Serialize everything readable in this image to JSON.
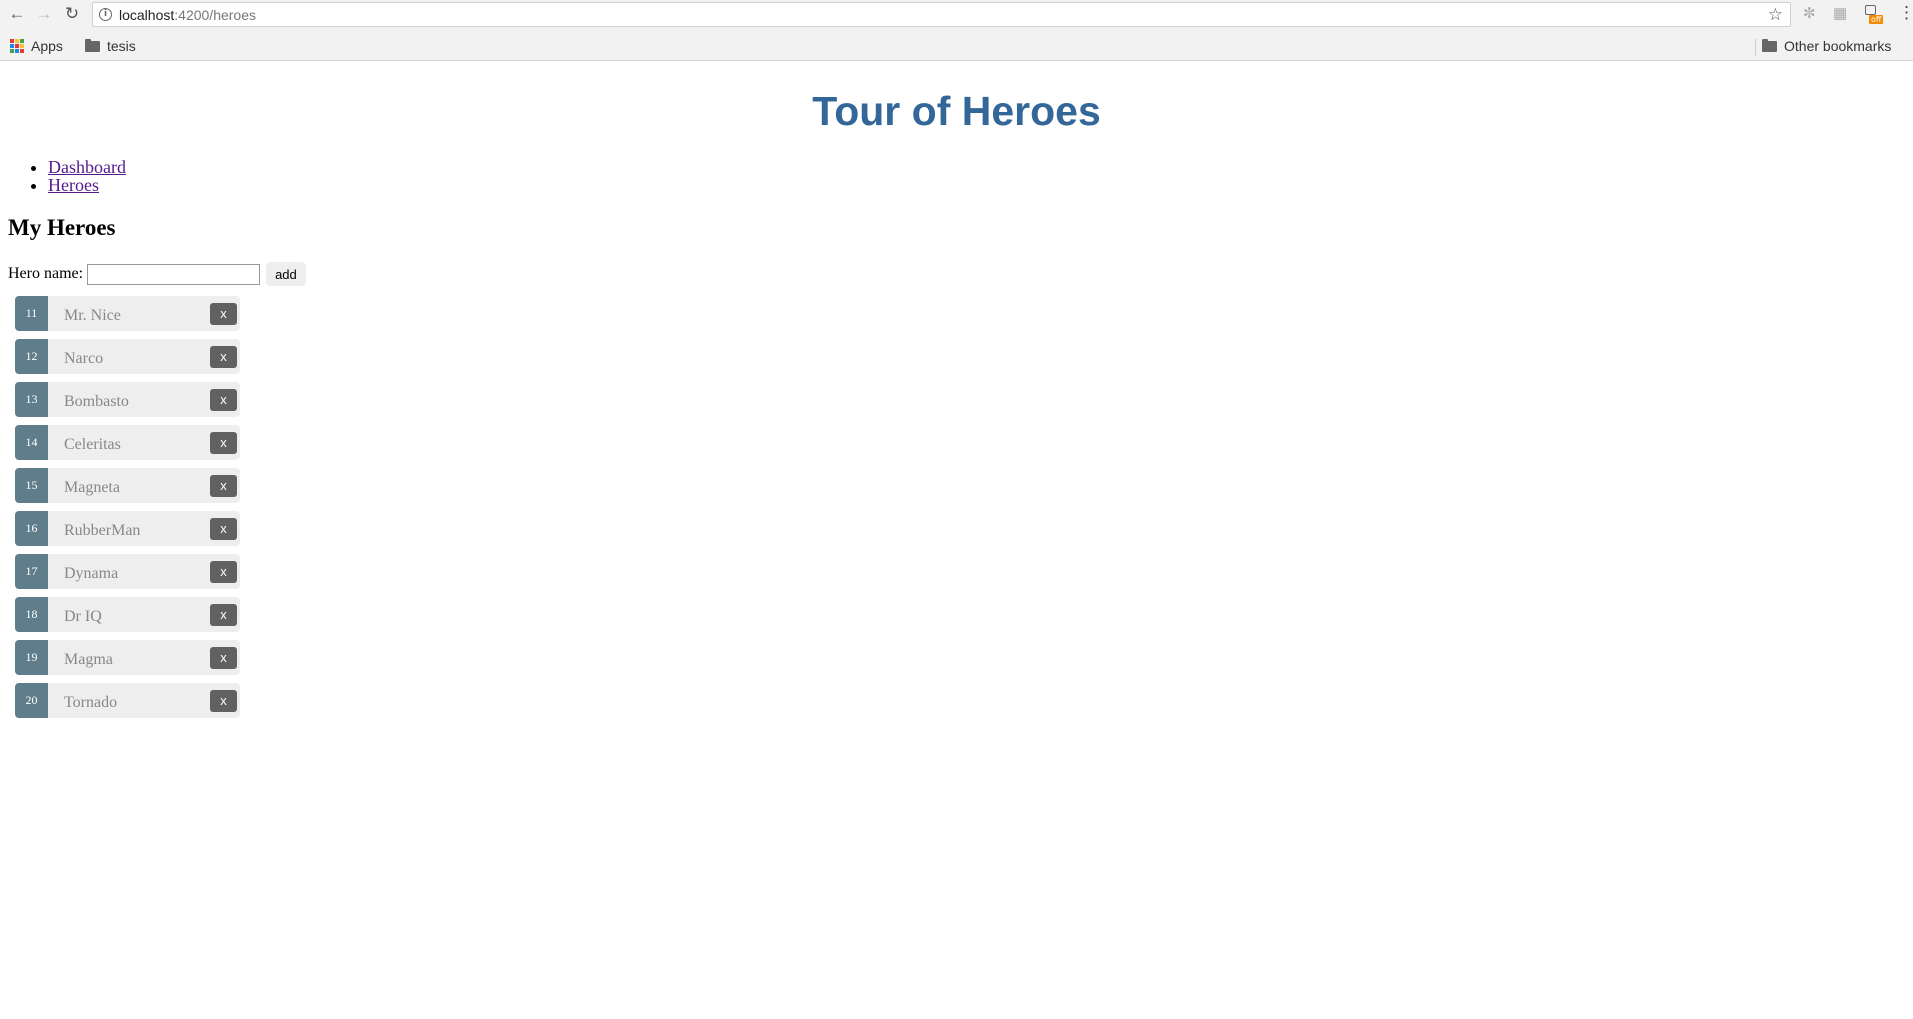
{
  "browser": {
    "url_host": "localhost",
    "url_path": ":4200/heroes",
    "bookmarks": {
      "apps_label": "Apps",
      "folder_label": "tesis",
      "other_label": "Other bookmarks"
    },
    "extension_badge": "off",
    "apps_colors": [
      "#e53935",
      "#fbc02d",
      "#43a047",
      "#1e88e5",
      "#e53935",
      "#fbc02d",
      "#43a047",
      "#1e88e5",
      "#e53935"
    ]
  },
  "app": {
    "title": "Tour of Heroes",
    "nav": [
      {
        "label": "Dashboard"
      },
      {
        "label": "Heroes"
      }
    ]
  },
  "heroes_page": {
    "title": "My Heroes",
    "hero_name_label": "Hero name:",
    "hero_name_value": "",
    "add_label": "add",
    "delete_label": "x",
    "heroes": [
      {
        "id": "11",
        "name": "Mr. Nice"
      },
      {
        "id": "12",
        "name": "Narco"
      },
      {
        "id": "13",
        "name": "Bombasto"
      },
      {
        "id": "14",
        "name": "Celeritas"
      },
      {
        "id": "15",
        "name": "Magneta"
      },
      {
        "id": "16",
        "name": "RubberMan"
      },
      {
        "id": "17",
        "name": "Dynama"
      },
      {
        "id": "18",
        "name": "Dr IQ"
      },
      {
        "id": "19",
        "name": "Magma"
      },
      {
        "id": "20",
        "name": "Tornado"
      }
    ]
  },
  "colors": {
    "title": "#336699",
    "badge": "#607d8b",
    "delete": "#616161",
    "row_bg": "#eeeeee"
  }
}
